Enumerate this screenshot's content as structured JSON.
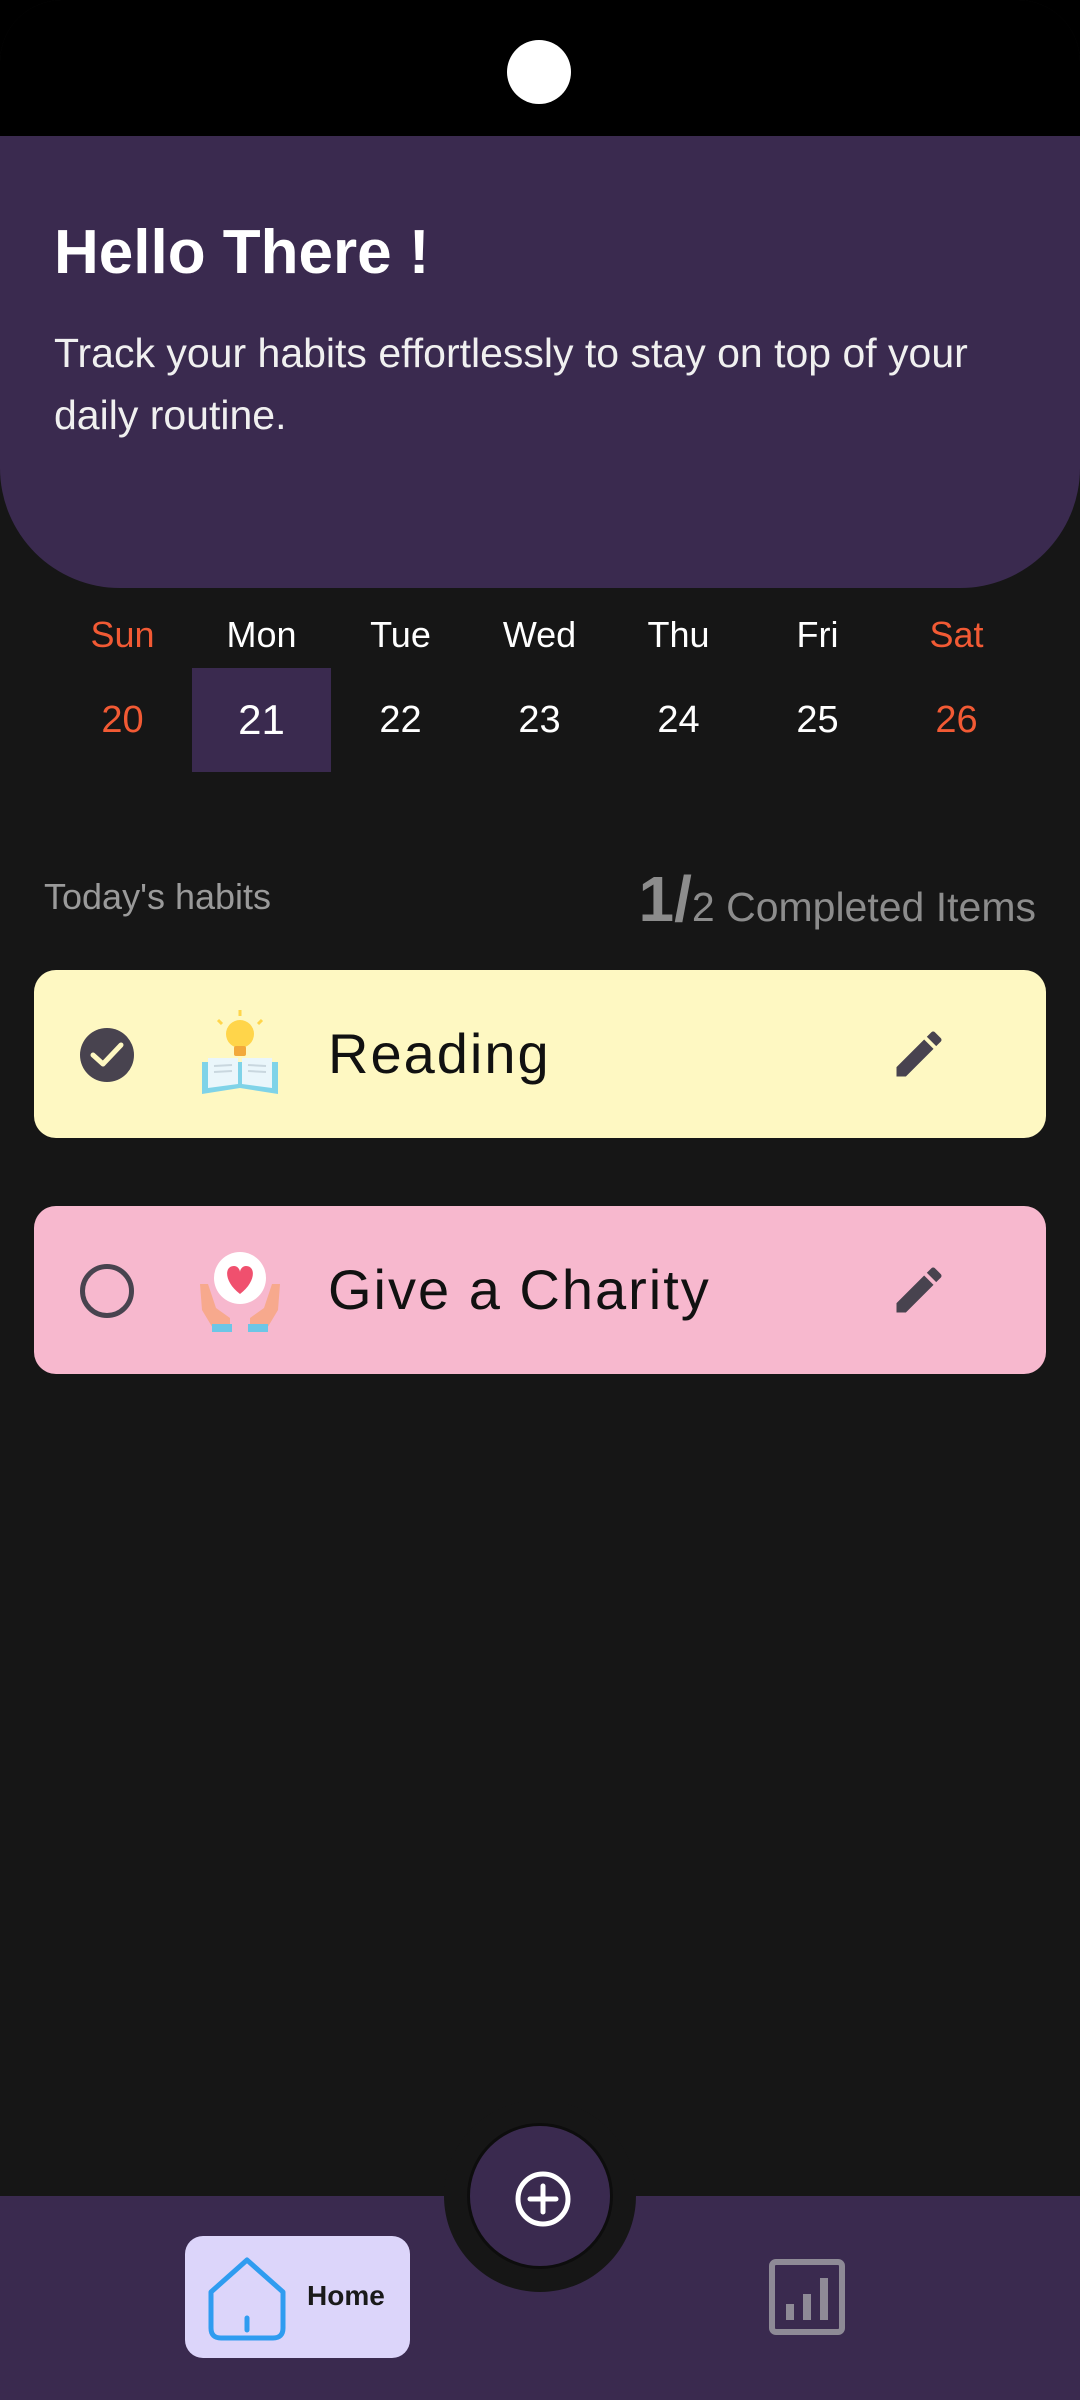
{
  "header": {
    "title": "Hello There !",
    "subtitle": "Track your habits effortlessly to stay on top of your daily routine."
  },
  "week": {
    "days": [
      {
        "name": "Sun",
        "num": "20",
        "weekend": true
      },
      {
        "name": "Mon",
        "num": "21",
        "selected": true
      },
      {
        "name": "Tue",
        "num": "22"
      },
      {
        "name": "Wed",
        "num": "23"
      },
      {
        "name": "Thu",
        "num": "24"
      },
      {
        "name": "Fri",
        "num": "25"
      },
      {
        "name": "Sat",
        "num": "26",
        "weekend": true
      }
    ],
    "weekend_color": "#f25a34",
    "selected_bg": "#3a2a4f"
  },
  "habits": {
    "label": "Today's habits",
    "completed_count": "1/",
    "completed_rest": "2 Completed Items",
    "items": [
      {
        "name": "Reading",
        "done": true,
        "icon": "book-lightbulb-icon",
        "color": "#fef8c2"
      },
      {
        "name": "Give a Charity",
        "done": false,
        "icon": "charity-heart-hands-icon",
        "color": "#f7b8ce"
      }
    ]
  },
  "nav": {
    "home_label": "Home",
    "fab_icon": "add-circle-icon",
    "stats_icon": "bar-chart-icon"
  },
  "colors": {
    "primary": "#3a2a4f",
    "background": "#161616",
    "home_pill": "#dcd5fa"
  }
}
